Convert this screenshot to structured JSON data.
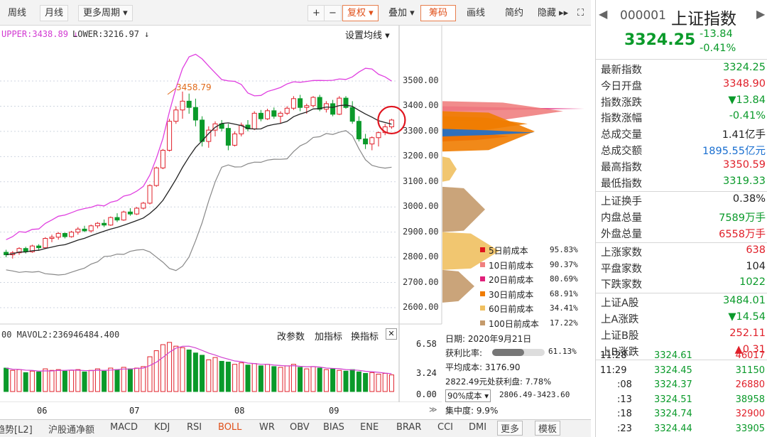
{
  "toolbar": {
    "left": [
      "周线",
      "月线",
      "更多周期 ▾"
    ],
    "right": [
      "+",
      "−",
      "复权 ▾",
      "叠加 ▾",
      "筹码",
      "画线",
      "简约",
      "隐藏 ▸▸",
      "⛶"
    ]
  },
  "chart_header": {
    "upper": "UPPER:3438.89 ↓",
    "lower": "LOWER:3216.97 ↓",
    "settings": "设置均线 ▾",
    "high_annotation": "3458.79"
  },
  "price_axis": [
    "3500.00",
    "3400.00",
    "3300.00",
    "3200.00",
    "3100.00",
    "3000.00",
    "2900.00",
    "2800.00",
    "2700.00",
    "2600.00"
  ],
  "volume_header": {
    "mavol": "00  MAVOL2:236946484.400",
    "buttons": [
      "改参数",
      "加指标",
      "换指标",
      "✕"
    ]
  },
  "volume_axis": [
    "6.58",
    "3.24",
    "0.00"
  ],
  "months": [
    "06",
    "07",
    "08",
    "09"
  ],
  "chart_data": {
    "type": "candlestick",
    "candles": [
      [
        2820,
        2830,
        2800,
        2810
      ],
      [
        2810,
        2825,
        2795,
        2818
      ],
      [
        2818,
        2840,
        2810,
        2835
      ],
      [
        2835,
        2842,
        2815,
        2822
      ],
      [
        2822,
        2850,
        2818,
        2845
      ],
      [
        2845,
        2852,
        2830,
        2838
      ],
      [
        2838,
        2880,
        2835,
        2875
      ],
      [
        2875,
        2890,
        2860,
        2880
      ],
      [
        2880,
        2900,
        2870,
        2895
      ],
      [
        2895,
        2898,
        2875,
        2882
      ],
      [
        2882,
        2905,
        2878,
        2900
      ],
      [
        2900,
        2920,
        2890,
        2912
      ],
      [
        2912,
        2925,
        2900,
        2905
      ],
      [
        2905,
        2930,
        2898,
        2925
      ],
      [
        2925,
        2940,
        2915,
        2935
      ],
      [
        2935,
        2950,
        2920,
        2928
      ],
      [
        2928,
        2962,
        2925,
        2958
      ],
      [
        2958,
        2975,
        2940,
        2948
      ],
      [
        2948,
        2985,
        2945,
        2980
      ],
      [
        2980,
        2995,
        2965,
        2972
      ],
      [
        2972,
        3000,
        2968,
        2995
      ],
      [
        2995,
        3020,
        2990,
        3015
      ],
      [
        3015,
        3090,
        3010,
        3085
      ],
      [
        3085,
        3160,
        3080,
        3155
      ],
      [
        3155,
        3230,
        3150,
        3225
      ],
      [
        3225,
        3350,
        3220,
        3340
      ],
      [
        3340,
        3400,
        3330,
        3385
      ],
      [
        3385,
        3458,
        3350,
        3420
      ],
      [
        3420,
        3450,
        3370,
        3395
      ],
      [
        3395,
        3430,
        3320,
        3345
      ],
      [
        3345,
        3360,
        3240,
        3260
      ],
      [
        3260,
        3320,
        3235,
        3305
      ],
      [
        3305,
        3340,
        3280,
        3330
      ],
      [
        3330,
        3345,
        3300,
        3312
      ],
      [
        3312,
        3330,
        3225,
        3245
      ],
      [
        3245,
        3300,
        3240,
        3290
      ],
      [
        3290,
        3335,
        3280,
        3325
      ],
      [
        3325,
        3345,
        3300,
        3310
      ],
      [
        3310,
        3380,
        3305,
        3372
      ],
      [
        3372,
        3385,
        3340,
        3350
      ],
      [
        3350,
        3390,
        3345,
        3382
      ],
      [
        3382,
        3395,
        3350,
        3360
      ],
      [
        3360,
        3380,
        3330,
        3372
      ],
      [
        3372,
        3400,
        3365,
        3392
      ],
      [
        3392,
        3440,
        3385,
        3430
      ],
      [
        3430,
        3445,
        3380,
        3395
      ],
      [
        3395,
        3410,
        3370,
        3402
      ],
      [
        3402,
        3440,
        3395,
        3435
      ],
      [
        3435,
        3445,
        3380,
        3388
      ],
      [
        3388,
        3420,
        3375,
        3410
      ],
      [
        3410,
        3425,
        3360,
        3368
      ],
      [
        3368,
        3440,
        3365,
        3432
      ],
      [
        3432,
        3440,
        3390,
        3395
      ],
      [
        3395,
        3420,
        3330,
        3340
      ],
      [
        3340,
        3360,
        3260,
        3270
      ],
      [
        3270,
        3290,
        3230,
        3250
      ],
      [
        3250,
        3280,
        3225,
        3275
      ],
      [
        3275,
        3300,
        3240,
        3295
      ],
      [
        3295,
        3330,
        3285,
        3318
      ],
      [
        3318,
        3350,
        3310,
        3345
      ]
    ],
    "bands": {
      "upper": "UPPER",
      "mid": "MID",
      "lower": "LOWER"
    },
    "ylim": [
      2600,
      3500
    ],
    "volume": [
      3.1,
      2.8,
      2.9,
      2.5,
      2.7,
      2.6,
      3.0,
      2.8,
      2.9,
      2.7,
      2.8,
      2.9,
      2.6,
      2.8,
      3.0,
      2.7,
      3.1,
      2.9,
      3.2,
      3.0,
      3.1,
      3.3,
      4.6,
      5.4,
      6.2,
      6.5,
      6.0,
      5.8,
      5.5,
      5.1,
      4.8,
      4.2,
      4.5,
      4.0,
      3.9,
      3.6,
      3.8,
      3.5,
      3.7,
      3.4,
      3.6,
      3.3,
      3.2,
      3.4,
      3.6,
      3.2,
      3.0,
      3.3,
      3.1,
      2.9,
      3.0,
      2.8,
      2.7,
      2.9,
      2.6,
      2.4,
      2.5,
      2.3,
      2.4,
      2.2
    ]
  },
  "cost_panel": {
    "legend": [
      {
        "label": "5日前成本",
        "value": "95.83%",
        "color": "#e0141e"
      },
      {
        "label": "10日前成本",
        "value": "90.37%",
        "color": "#f08080"
      },
      {
        "label": "20日前成本",
        "value": "80.69%",
        "color": "#e0207a"
      },
      {
        "label": "30日前成本",
        "value": "68.91%",
        "color": "#f07c00"
      },
      {
        "label": "60日前成本",
        "value": "34.41%",
        "color": "#f0c060"
      },
      {
        "label": "100日前成本",
        "value": "17.22%",
        "color": "#c49a6c"
      }
    ],
    "date": "日期: 2020年9月21日",
    "profit_label": "获利比率:",
    "profit_value": "61.13%",
    "profit_ratio": 0.6113,
    "avg_cost": "平均成本: 3176.90",
    "line3": "2822.49元处获利盘: 7.78%",
    "select": "90%成本 ▾",
    "range": "2806.49-3423.60",
    "concentration": "集中度: 9.9%"
  },
  "bottom_tabs": [
    "趋势[L2]",
    "沪股通净额",
    "MACD",
    "KDJ",
    "RSI",
    "BOLL",
    "WR",
    "OBV",
    "BIAS",
    "ENE",
    "BRAR",
    "CCI",
    "DMI",
    "更多",
    "模板"
  ],
  "active_tab": "BOLL",
  "side": {
    "code": "000001",
    "name": "上证指数",
    "price": "3324.25",
    "change": "-13.84",
    "pct": "-0.41%",
    "rows1": [
      {
        "l": "最新指数",
        "v": "3324.25",
        "c": "green"
      },
      {
        "l": "今日开盘",
        "v": "3348.90",
        "c": "red"
      },
      {
        "l": "指数涨跌",
        "v": "▼13.84",
        "c": "green"
      },
      {
        "l": "指数涨幅",
        "v": "-0.41%",
        "c": "green"
      },
      {
        "l": "总成交量",
        "v": "1.41亿手",
        "c": "blk"
      },
      {
        "l": "总成交额",
        "v": "1895.55亿元",
        "c": "blue"
      },
      {
        "l": "最高指数",
        "v": "3350.59",
        "c": "red"
      },
      {
        "l": "最低指数",
        "v": "3319.33",
        "c": "green"
      }
    ],
    "rows2": [
      {
        "l": "上证换手",
        "v": "0.38%",
        "c": "blk"
      },
      {
        "l": "内盘总量",
        "v": "7589万手",
        "c": "green"
      },
      {
        "l": "外盘总量",
        "v": "6558万手",
        "c": "red"
      }
    ],
    "rows3": [
      {
        "l": "上涨家数",
        "v": "638",
        "c": "red"
      },
      {
        "l": "平盘家数",
        "v": "104",
        "c": "blk"
      },
      {
        "l": "下跌家数",
        "v": "1022",
        "c": "green"
      }
    ],
    "rows4": [
      {
        "l": "上证A股",
        "v": "3484.01",
        "c": "green"
      },
      {
        "l": "上A涨跌",
        "v": "▼14.54",
        "c": "green"
      },
      {
        "l": "上证B股",
        "v": "252.11",
        "c": "red"
      },
      {
        "l": "上B涨跌",
        "v": "▲0.31",
        "c": "red"
      }
    ],
    "ticks": [
      {
        "t": "11:28",
        "p": "3324.61",
        "v": "46017"
      },
      {
        "t": "11:29",
        "p": "3324.45",
        "v": "31150"
      },
      {
        "t": ":08",
        "p": "3324.37",
        "v": "26880"
      },
      {
        "t": ":13",
        "p": "3324.51",
        "v": "38958"
      },
      {
        "t": ":18",
        "p": "3324.74",
        "v": "32900"
      },
      {
        "t": ":23",
        "p": "3324.44",
        "v": "33905"
      }
    ]
  }
}
